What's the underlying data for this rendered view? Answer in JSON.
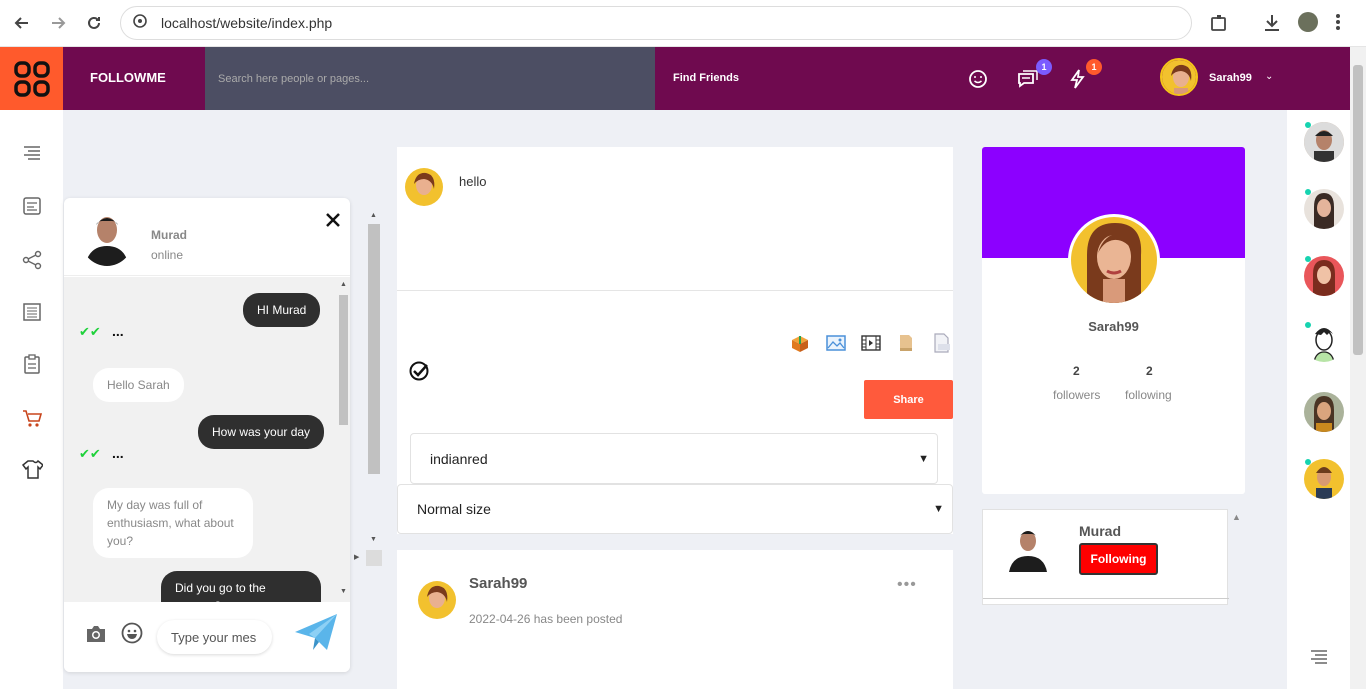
{
  "browser": {
    "url": "localhost/website/index.php"
  },
  "header": {
    "brand": "FOLLOWME",
    "search_placeholder": "Search here people or pages...",
    "find_friends": "Find Friends",
    "messages_badge": "1",
    "notifications_badge": "1",
    "user_name": "Sarah99",
    "accent_color": "#6f0a4f",
    "logo_color": "#ff5a2c"
  },
  "chat": {
    "contact_name": "Murad",
    "contact_status": "online",
    "messages": [
      {
        "from": "me",
        "text": "HI Murad"
      },
      {
        "from": "them",
        "text": "Hello Sarah"
      },
      {
        "from": "me",
        "text": "How was your day"
      },
      {
        "from": "them",
        "text": "My day was full of enthusiasm, what about you?"
      },
      {
        "from": "me",
        "text": "Did you go to the concert?"
      }
    ],
    "ticks": "✔✔",
    "typing": "...",
    "input_placeholder": "Type your mes"
  },
  "composer": {
    "post_text": "hello",
    "share_label": "Share",
    "color_select": "indianred",
    "size_select": "Normal size"
  },
  "post": {
    "author": "Sarah99",
    "date_text": "2022-04-26 has been posted",
    "more": "•••"
  },
  "profile": {
    "name": "Sarah99",
    "followers_count": "2",
    "followers_label": "followers",
    "following_count": "2",
    "following_label": "following",
    "banner_color": "#8c00ff"
  },
  "following": {
    "name": "Murad",
    "button_label": "Following"
  }
}
